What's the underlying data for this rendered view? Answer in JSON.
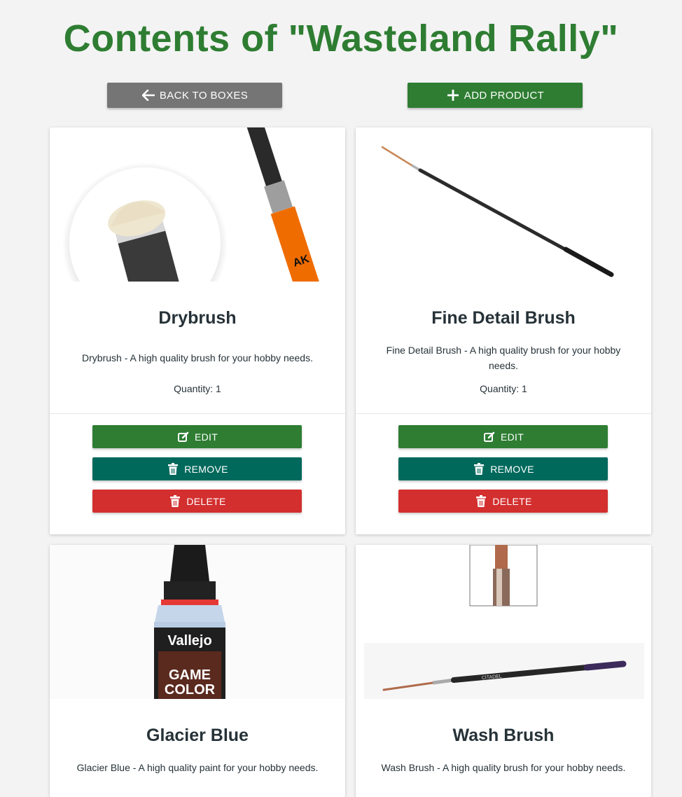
{
  "page": {
    "title": "Contents of \"Wasteland Rally\"",
    "back_label": "BACK TO BOXES",
    "add_label": "ADD PRODUCT"
  },
  "products": [
    {
      "name": "Drybrush",
      "description": "Drybrush - A high quality brush for your hobby needs.",
      "quantity": "Quantity: 1",
      "image_text": "AK"
    },
    {
      "name": "Fine Detail Brush",
      "description": "Fine Detail Brush - A high quality brush for your hobby needs.",
      "quantity": "Quantity: 1"
    },
    {
      "name": "Glacier Blue",
      "description": "Glacier Blue - A high quality paint for your hobby needs.",
      "image_brand": "Vallejo",
      "image_line1": "GAME",
      "image_line2": "COLOR"
    },
    {
      "name": "Wash Brush",
      "description": "Wash Brush - A high quality brush for your hobby needs.",
      "image_text": "CITADEL"
    }
  ],
  "actions": {
    "edit": "EDIT",
    "remove": "REMOVE",
    "delete": "DELETE"
  },
  "icons": {
    "back": "arrow-left-icon",
    "add": "plus-icon",
    "edit": "edit-icon",
    "trash": "trash-icon"
  },
  "colors": {
    "title": "#2e7d32",
    "back_button": "#757575",
    "add_button": "#2e7d32",
    "edit_button": "#2e7d32",
    "remove_button": "#00695c",
    "delete_button": "#d32f2f",
    "background": "#f3f3f3"
  }
}
